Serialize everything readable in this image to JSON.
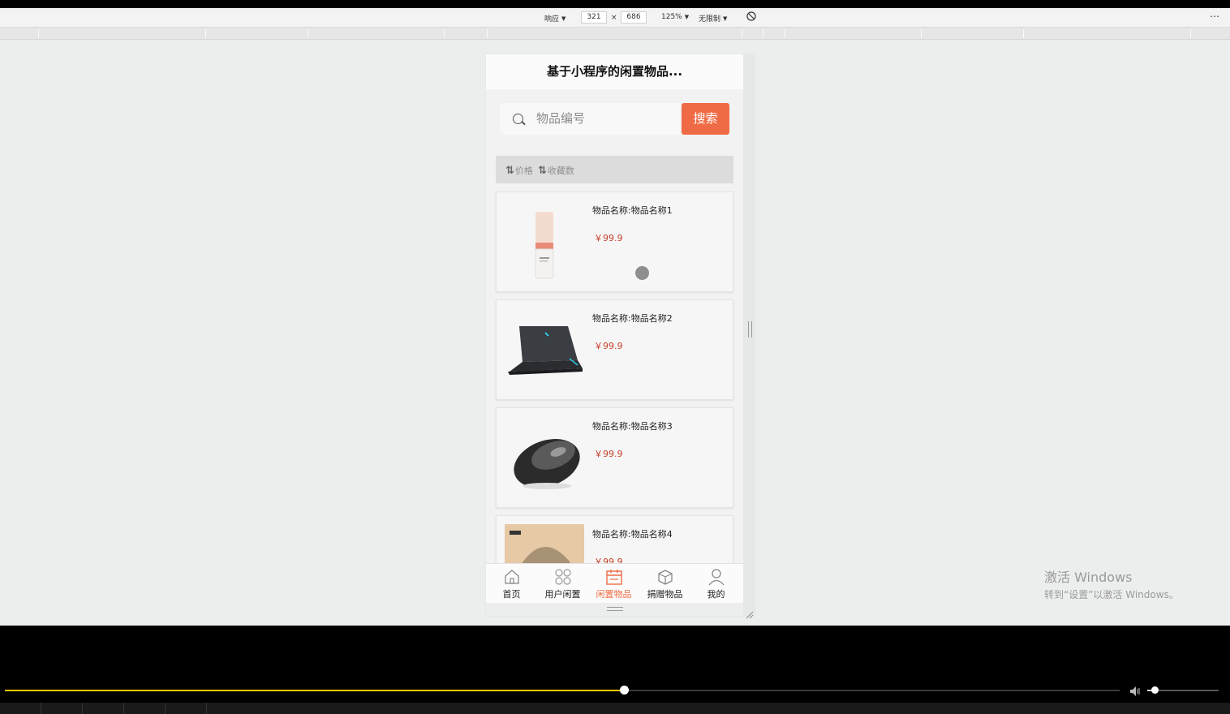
{
  "devtools": {
    "device_mode": "响应",
    "width": "321",
    "times": "×",
    "height": "686",
    "zoom": "125%",
    "throttle": "无限制",
    "more_icon": "⋯"
  },
  "app": {
    "title": "基于小程序的闲置物品...",
    "search": {
      "placeholder": "物品编号",
      "button_label": "搜索"
    },
    "sort": {
      "price_label": "价格",
      "favorites_label": "收藏数"
    },
    "items": [
      {
        "name": "物品名称:物品名称1",
        "price": "￥99.9",
        "image": "serum-bottle"
      },
      {
        "name": "物品名称:物品名称2",
        "price": "￥99.9",
        "image": "laptop"
      },
      {
        "name": "物品名称:物品名称3",
        "price": "￥99.9",
        "image": "mouse"
      },
      {
        "name": "物品名称:物品名称4",
        "price": "￥99.9",
        "image": "cap-photo"
      }
    ],
    "tabbar": {
      "tabs": [
        {
          "label": "首页",
          "icon": "home-icon",
          "active": false
        },
        {
          "label": "用户闲置",
          "icon": "grid-icon",
          "active": false
        },
        {
          "label": "闲置物品",
          "icon": "calendar-icon",
          "active": true
        },
        {
          "label": "捐赠物品",
          "icon": "box-icon",
          "active": false
        },
        {
          "label": "我的",
          "icon": "user-icon",
          "active": false
        }
      ]
    },
    "accent_color": "#ef6b45",
    "price_color": "#c8402a"
  },
  "watermark": {
    "line1": "激活 Windows",
    "line2": "转到“设置”以激活 Windows。"
  },
  "player": {
    "progress": 0.555,
    "volume": 0.1,
    "progress_color": "#e8c800"
  }
}
